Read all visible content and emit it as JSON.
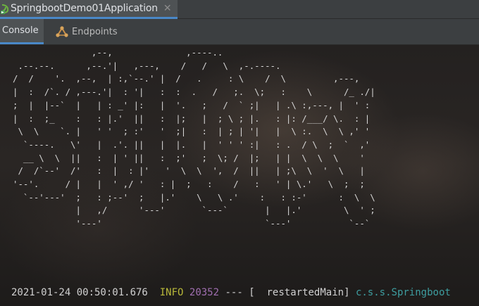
{
  "run_tab": {
    "title": "SpringbootDemo01Application",
    "close_glyph": "✕",
    "icon": "spring-boot-run-icon"
  },
  "tool_tabs": [
    {
      "label": "Console",
      "icon": null,
      "active": true
    },
    {
      "label": "Endpoints",
      "icon": "endpoints-icon",
      "active": false
    }
  ],
  "console": {
    "banner": "               ,--,              ,----..\n .--.--.      ,--.'|   ,---,    /   /   \\  ,-.----.\n/  /    '.  ,--,  | :,`--.' |  /   .     : \\    /  \\         ,---,\n|  :  /`. / ,---.'|  : '|   :  :  .   /   ;.  \\;   :    \\      /_ ./|\n;  |  |--`  |   | : _' |:   |  '.   ;   /  ` ;|   | .\\ :,---, |  ' :\n|  :  ;_    :   : |.'  ||   :  |;   |  ; \\ ; |.   : |: /___/ \\.  : |\n \\  \\    `. |   ' '  ; :'   '  ;|   :  | ; | '|   |  \\ :.  \\  \\ ,' '\n  `----.   \\'   |  .'. ||   |  |.   |  ' ' ' :|   : .  / \\  ;  `  ,'\n  __ \\  \\  ||   :  | ' ||   :  ;'   ;  \\; /  |;   | |  \\  \\  \\    '\n /  /`--'  /'   :  |  : |'   '  \\  \\  ',  /  ||   | ;\\  \\  '  \\   |\n'--'.     / |   |  ' ,/ '   : |  ;   :    /   :   ' | \\.'   \\  ;  ;\n  `--'---'  ;   : ;--'  ;   |.'    \\   \\ .'    :   : :-'      :  \\  \\\n            |   ,/      '---'       `---`       |   |.'        \\  ' ;\n            '---'                               `---'           `--`",
    "log": {
      "timestamp": "2021-01-24 00:50:01.676",
      "level": "INFO",
      "pid": "20352",
      "separator": "---",
      "thread": "[  restartedMain]",
      "logger": "c.s.s.Springboot"
    }
  },
  "colors": {
    "accent": "#4a88c7",
    "log_level": "#b8b83a",
    "log_pid": "#a06fb0",
    "log_logger": "#3e9ea0"
  }
}
